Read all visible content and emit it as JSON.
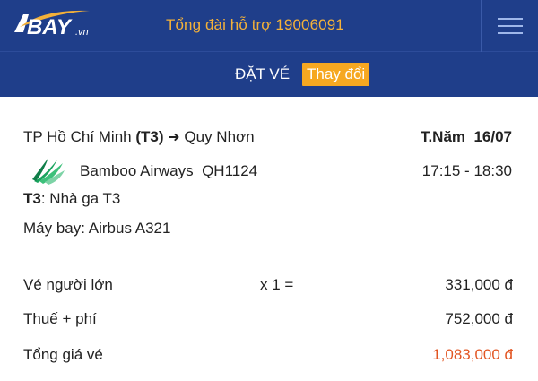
{
  "header": {
    "logo_text": "BAY",
    "logo_domain": ".vn",
    "hotline": "Tổng đài hỗ trợ 19006091",
    "menu_icon": "hamburger-menu-icon"
  },
  "booking_bar": {
    "title": "ĐẶT VÉ",
    "change_label": "Thay đổi"
  },
  "flight": {
    "origin": "TP Hồ Chí Minh",
    "origin_terminal": "(T3)",
    "arrow_icon": "arrow-right-icon",
    "destination": "Quy Nhơn",
    "date": "T.Năm  16/07",
    "airline": "Bamboo Airways",
    "flight_no": "QH1124",
    "time": "17:15 - 18:30",
    "terminal_code": "T3",
    "terminal_name": ": Nhà ga T3",
    "aircraft": "Máy bay: Airbus A321"
  },
  "fares": {
    "adult_label": "Vé người lớn",
    "adult_multiplier": "x 1 =",
    "adult_amount": "331,000 đ",
    "tax_label": "Thuế + phí",
    "tax_amount": "752,000 đ",
    "total_label": "Tổng giá vé",
    "total_amount": "1,083,000 đ"
  },
  "colors": {
    "header_bg": "#1f3e8a",
    "hotline": "#f3b13a",
    "change_button": "#f6a821",
    "total_amount": "#e25522",
    "airline_logo": "#1aa35e"
  }
}
